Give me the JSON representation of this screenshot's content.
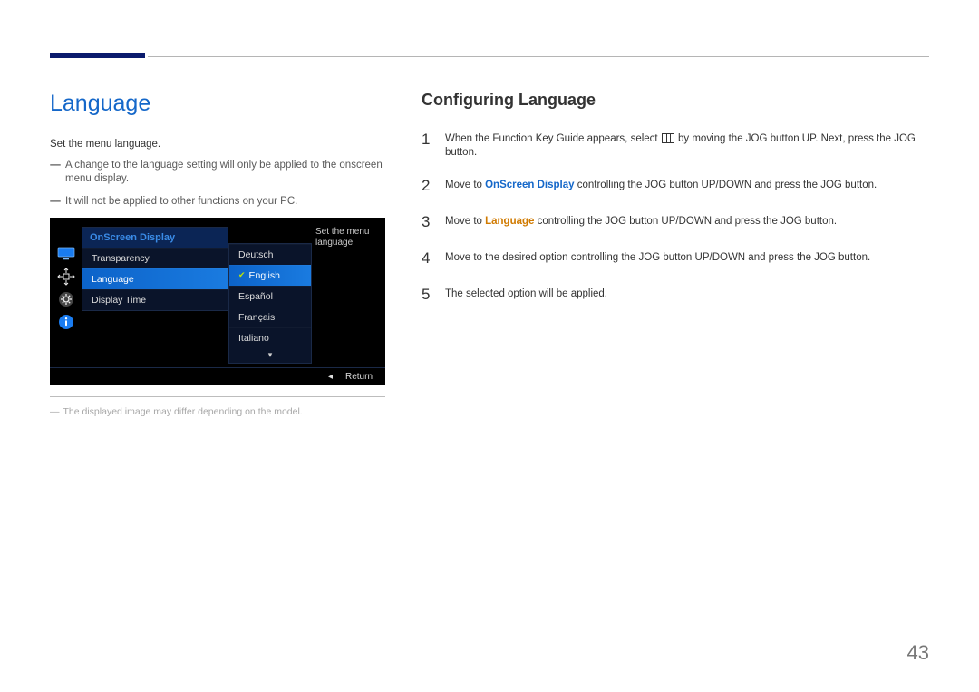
{
  "page_number": "43",
  "left": {
    "title": "Language",
    "intro": "Set the menu language.",
    "notes": [
      "A change to the language setting will only be applied to the onscreen menu display.",
      "It will not be applied to other functions on your PC."
    ],
    "footnote": "The displayed image may differ depending on the model."
  },
  "right": {
    "title": "Configuring Language",
    "steps": [
      {
        "n": "1",
        "pre": "When the Function Key Guide appears, select ",
        "hl": "",
        "post": " by moving the JOG button UP. Next, press the JOG button.",
        "menu_icon": true
      },
      {
        "n": "2",
        "pre": "Move to ",
        "hl": "OnScreen Display",
        "post": " controlling the JOG button UP/DOWN and press the JOG button.",
        "hl_class": "hl1"
      },
      {
        "n": "3",
        "pre": "Move to ",
        "hl": "Language",
        "post": " controlling the JOG button UP/DOWN and press the JOG button.",
        "hl_class": "hl2"
      },
      {
        "n": "4",
        "pre": "Move to the desired option controlling the JOG button UP/DOWN and press the JOG button.",
        "hl": "",
        "post": ""
      },
      {
        "n": "5",
        "pre": "The selected option will be applied.",
        "hl": "",
        "post": ""
      }
    ]
  },
  "osd": {
    "main_title": "OnScreen Display",
    "main_items": [
      "Transparency",
      "Language",
      "Display Time"
    ],
    "main_selected": 1,
    "sub_items": [
      "Deutsch",
      "English",
      "Español",
      "Français",
      "Italiano"
    ],
    "sub_selected": 1,
    "desc": "Set the menu language.",
    "back_arrow": "◂",
    "return_label": "Return",
    "down_arrow": "▾"
  }
}
